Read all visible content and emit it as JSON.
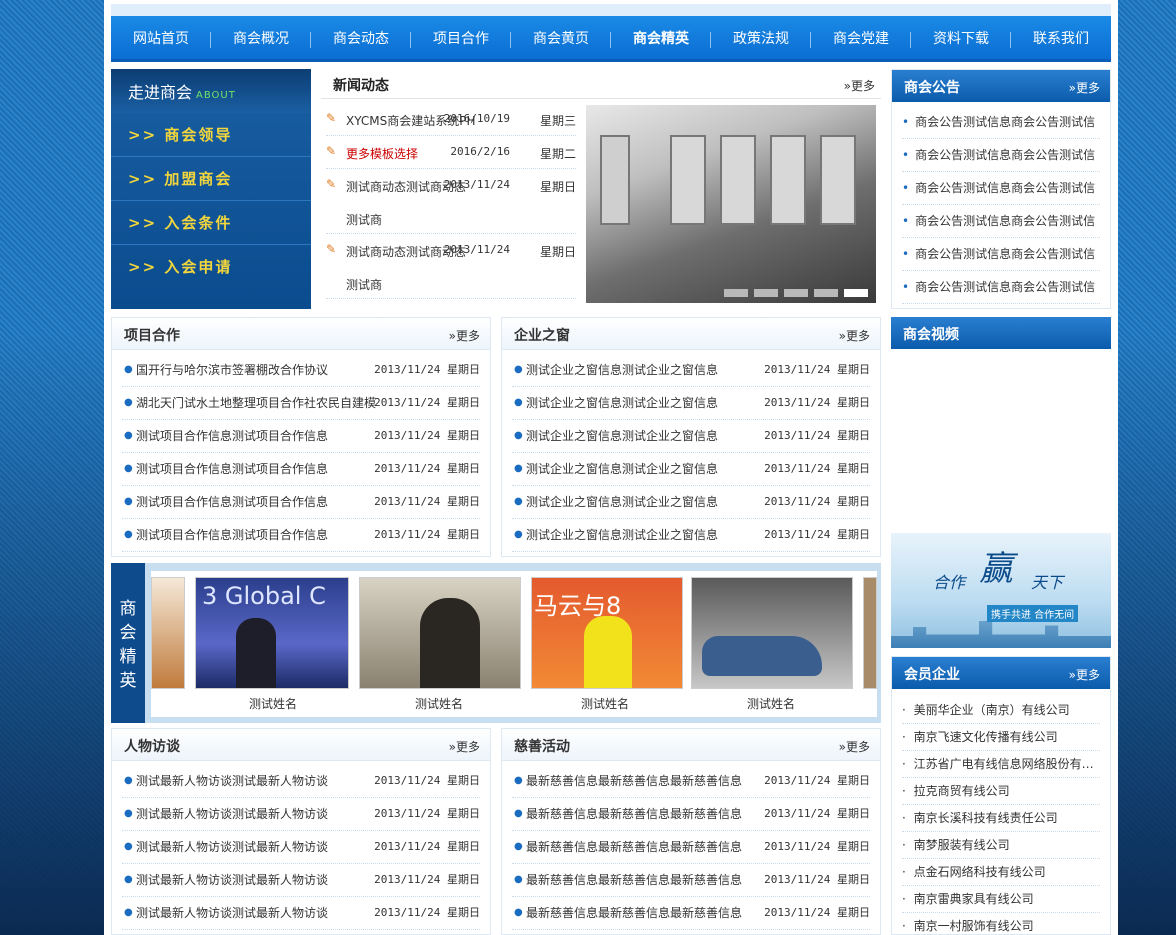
{
  "nav": [
    "网站首页",
    "商会概况",
    "商会动态",
    "项目合作",
    "商会黄页",
    "商会精英",
    "政策法规",
    "商会党建",
    "资料下载",
    "联系我们"
  ],
  "nav_active_index": 5,
  "about": {
    "title": "走进商会",
    "subtitle": "ABOUT",
    "links": [
      ">> 商会领导",
      ">> 加盟商会",
      ">> 入会条件",
      ">> 入会申请"
    ]
  },
  "news": {
    "title": "新闻动态",
    "more": "»更多",
    "items": [
      {
        "text": "XYCMS商会建站系统PH",
        "date": "2016/10/19",
        "week": "星期三",
        "highlight": false
      },
      {
        "text": "更多模板选择",
        "date": "2016/2/16",
        "week": "星期二",
        "highlight": true
      },
      {
        "text": "测试商动态测试商动态",
        "text2": "测试商",
        "date": "2013/11/24",
        "week": "星期日",
        "highlight": false
      },
      {
        "text": "测试商动态测试商动态",
        "text2": "测试商",
        "date": "2013/11/24",
        "week": "星期日",
        "highlight": false
      }
    ]
  },
  "notice": {
    "title": "商会公告",
    "more": "»更多",
    "items": [
      "商会公告测试信息商会公告测试信",
      "商会公告测试信息商会公告测试信",
      "商会公告测试信息商会公告测试信",
      "商会公告测试信息商会公告测试信",
      "商会公告测试信息商会公告测试信",
      "商会公告测试信息商会公告测试信"
    ]
  },
  "project": {
    "title": "项目合作",
    "more": "»更多",
    "items": [
      {
        "text": "国开行与哈尔滨市签署棚改合作协议",
        "date": "2013/11/24 星期日"
      },
      {
        "text": "湖北天门试水土地整理项目合作社农民自建模",
        "date": "2013/11/24 星期日"
      },
      {
        "text": "测试项目合作信息测试项目合作信息",
        "date": "2013/11/24 星期日"
      },
      {
        "text": "测试项目合作信息测试项目合作信息",
        "date": "2013/11/24 星期日"
      },
      {
        "text": "测试项目合作信息测试项目合作信息",
        "date": "2013/11/24 星期日"
      },
      {
        "text": "测试项目合作信息测试项目合作信息",
        "date": "2013/11/24 星期日"
      }
    ]
  },
  "enterprise": {
    "title": "企业之窗",
    "more": "»更多",
    "items": [
      {
        "text": "测试企业之窗信息测试企业之窗信息",
        "date": "2013/11/24 星期日"
      },
      {
        "text": "测试企业之窗信息测试企业之窗信息",
        "date": "2013/11/24 星期日"
      },
      {
        "text": "测试企业之窗信息测试企业之窗信息",
        "date": "2013/11/24 星期日"
      },
      {
        "text": "测试企业之窗信息测试企业之窗信息",
        "date": "2013/11/24 星期日"
      },
      {
        "text": "测试企业之窗信息测试企业之窗信息",
        "date": "2013/11/24 星期日"
      },
      {
        "text": "测试企业之窗信息测试企业之窗信息",
        "date": "2013/11/24 星期日"
      }
    ]
  },
  "video": {
    "title": "商会视频"
  },
  "elite": {
    "label": [
      "商",
      "会",
      "精",
      "英"
    ],
    "captions": [
      "测试姓名",
      "测试姓名",
      "测试姓名",
      "测试姓名"
    ],
    "photo_texts": [
      "3 Global C",
      "",
      "马云与8",
      ""
    ]
  },
  "banner": {
    "t1": "合作",
    "t2": "赢",
    "t3": "天下",
    "sub": "携手共进  合作无间"
  },
  "member": {
    "title": "会员企业",
    "more": "»更多",
    "items": [
      "美丽华企业（南京）有线公司",
      "南京飞速文化传播有线公司",
      "江苏省广电有线信息网络股份有…",
      "拉克商贸有线公司",
      "南京长溪科技有线责任公司",
      "南梦服装有线公司",
      "点金石网络科技有线公司",
      "南京雷典家具有线公司",
      "南京一村服饰有线公司"
    ]
  },
  "interview": {
    "title": "人物访谈",
    "more": "»更多",
    "items": [
      {
        "text": "测试最新人物访谈测试最新人物访谈",
        "date": "2013/11/24 星期日"
      },
      {
        "text": "测试最新人物访谈测试最新人物访谈",
        "date": "2013/11/24 星期日"
      },
      {
        "text": "测试最新人物访谈测试最新人物访谈",
        "date": "2013/11/24 星期日"
      },
      {
        "text": "测试最新人物访谈测试最新人物访谈",
        "date": "2013/11/24 星期日"
      },
      {
        "text": "测试最新人物访谈测试最新人物访谈",
        "date": "2013/11/24 星期日"
      }
    ]
  },
  "charity": {
    "title": "慈善活动",
    "more": "»更多",
    "items": [
      {
        "text": "最新慈善信息最新慈善信息最新慈善信息",
        "date": "2013/11/24 星期日"
      },
      {
        "text": "最新慈善信息最新慈善信息最新慈善信息",
        "date": "2013/11/24 星期日"
      },
      {
        "text": "最新慈善信息最新慈善信息最新慈善信息",
        "date": "2013/11/24 星期日"
      },
      {
        "text": "最新慈善信息最新慈善信息最新慈善信息",
        "date": "2013/11/24 星期日"
      },
      {
        "text": "最新慈善信息最新慈善信息最新慈善信息",
        "date": "2013/11/24 星期日"
      }
    ]
  }
}
